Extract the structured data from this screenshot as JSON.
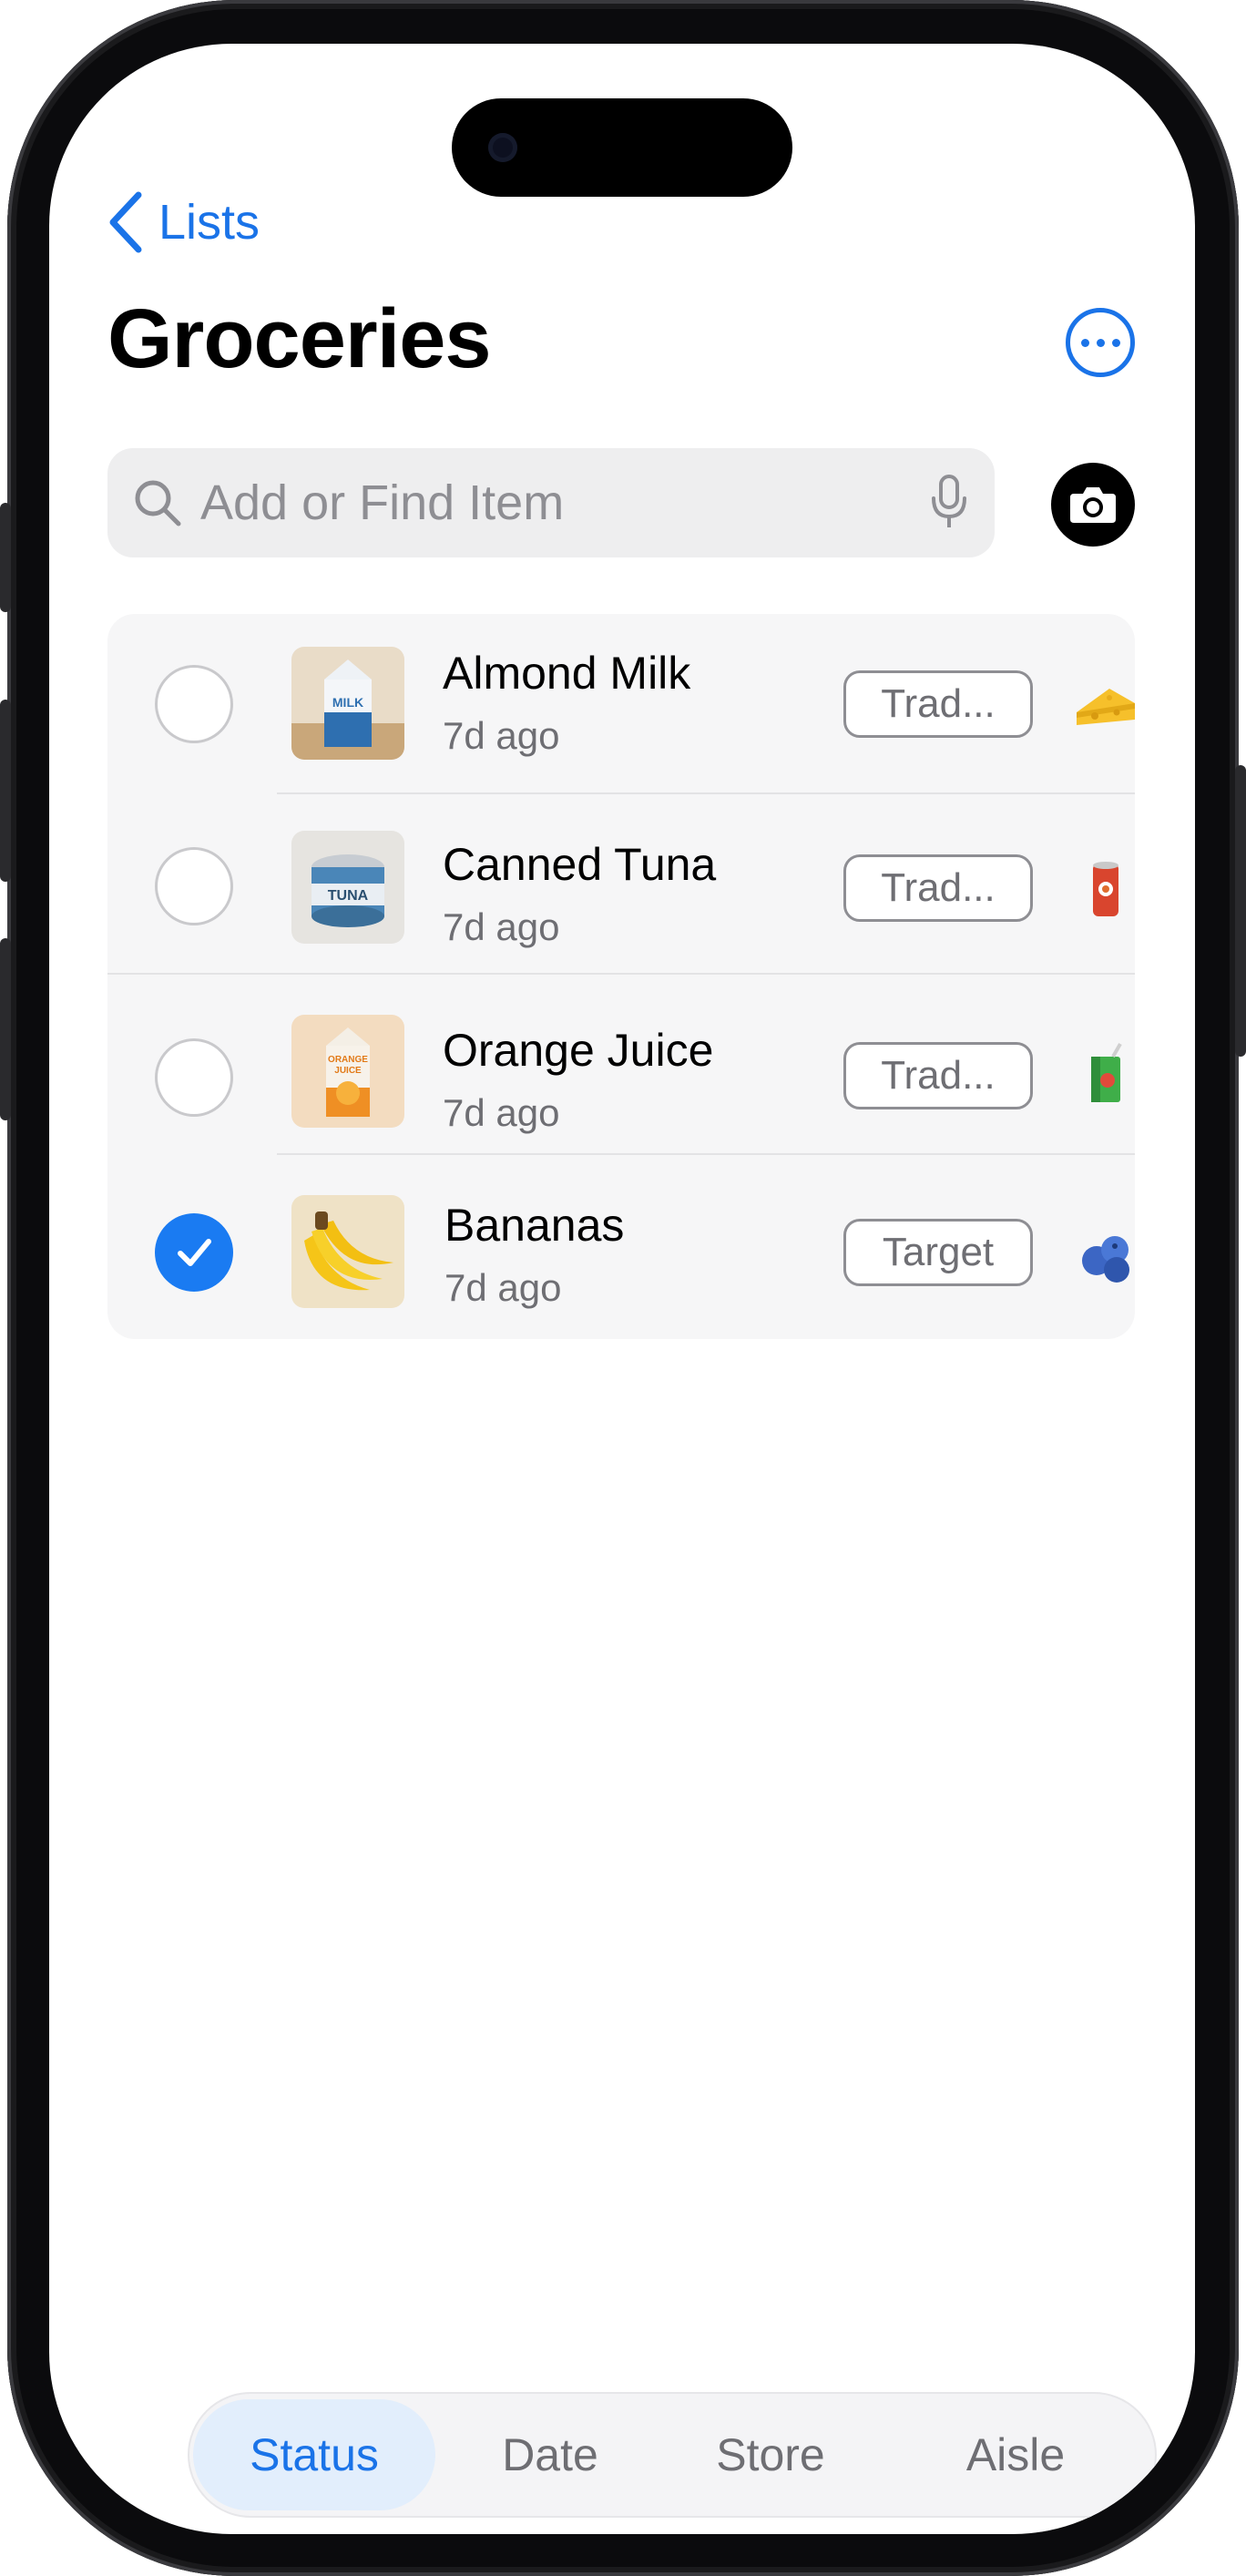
{
  "nav": {
    "back_label": "Lists",
    "title": "Groceries"
  },
  "search": {
    "placeholder": "Add or Find Item"
  },
  "items": [
    {
      "name": "Almond Milk",
      "time": "7d ago",
      "store": "Trad...",
      "checked": false,
      "thumb": "milk-carton",
      "aisle_icon": "cheese-icon"
    },
    {
      "name": "Canned Tuna",
      "time": "7d ago",
      "store": "Trad...",
      "checked": false,
      "thumb": "tuna-can",
      "aisle_icon": "canned-food-icon"
    },
    {
      "name": "Orange Juice",
      "time": "7d ago",
      "store": "Trad...",
      "checked": false,
      "thumb": "orange-juice-carton",
      "aisle_icon": "juice-box-icon"
    },
    {
      "name": "Bananas",
      "time": "7d ago",
      "store": "Target",
      "checked": true,
      "thumb": "bananas",
      "aisle_icon": "blueberries-icon"
    }
  ],
  "segments": {
    "status": "Status",
    "date": "Date",
    "store": "Store",
    "aisle": "Aisle",
    "active": "Status"
  },
  "colors": {
    "accent": "#1a73e8",
    "checked": "#1a7bf2"
  }
}
